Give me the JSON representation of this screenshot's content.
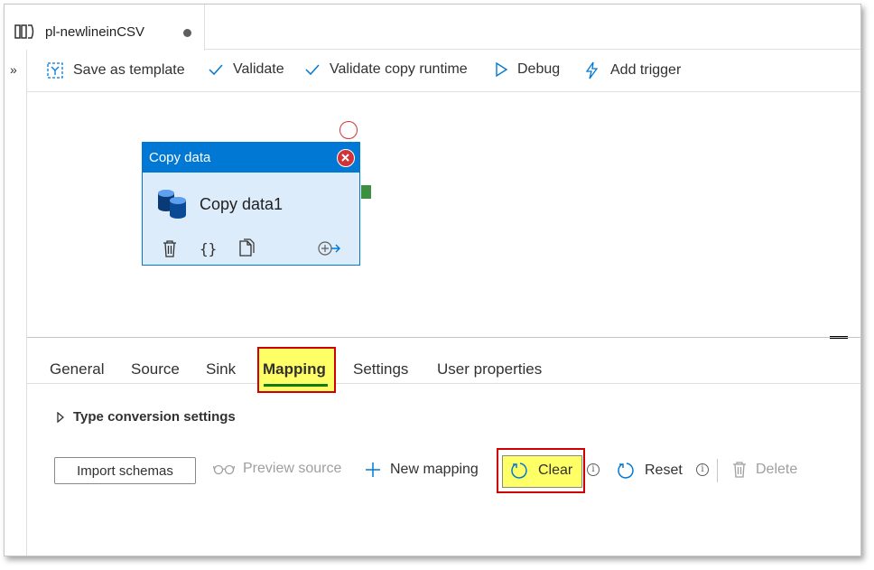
{
  "pipeline_tab": {
    "name": "pl-newlineinCSV",
    "icon": "pipeline-icon",
    "unsaved": true
  },
  "toolbar": {
    "save_template": "Save as template",
    "validate": "Validate",
    "validate_runtime": "Validate copy runtime",
    "debug": "Debug",
    "add_trigger": "Add trigger"
  },
  "activity": {
    "type_label": "Copy data",
    "name": "Copy data1"
  },
  "properties": {
    "tabs": [
      "General",
      "Source",
      "Sink",
      "Mapping",
      "Settings",
      "User properties"
    ],
    "active_tab": "Mapping"
  },
  "mapping": {
    "type_conversion": "Type conversion settings",
    "import_schemas": "Import schemas",
    "preview_source": "Preview source",
    "new_mapping": "New mapping",
    "clear": "Clear",
    "reset": "Reset",
    "delete": "Delete",
    "info_glyph": "i"
  },
  "colors": {
    "accent": "#0078d4",
    "highlight": "#ffff66",
    "annotation_red": "#d00000",
    "active_tab_underline": "#107c10"
  }
}
